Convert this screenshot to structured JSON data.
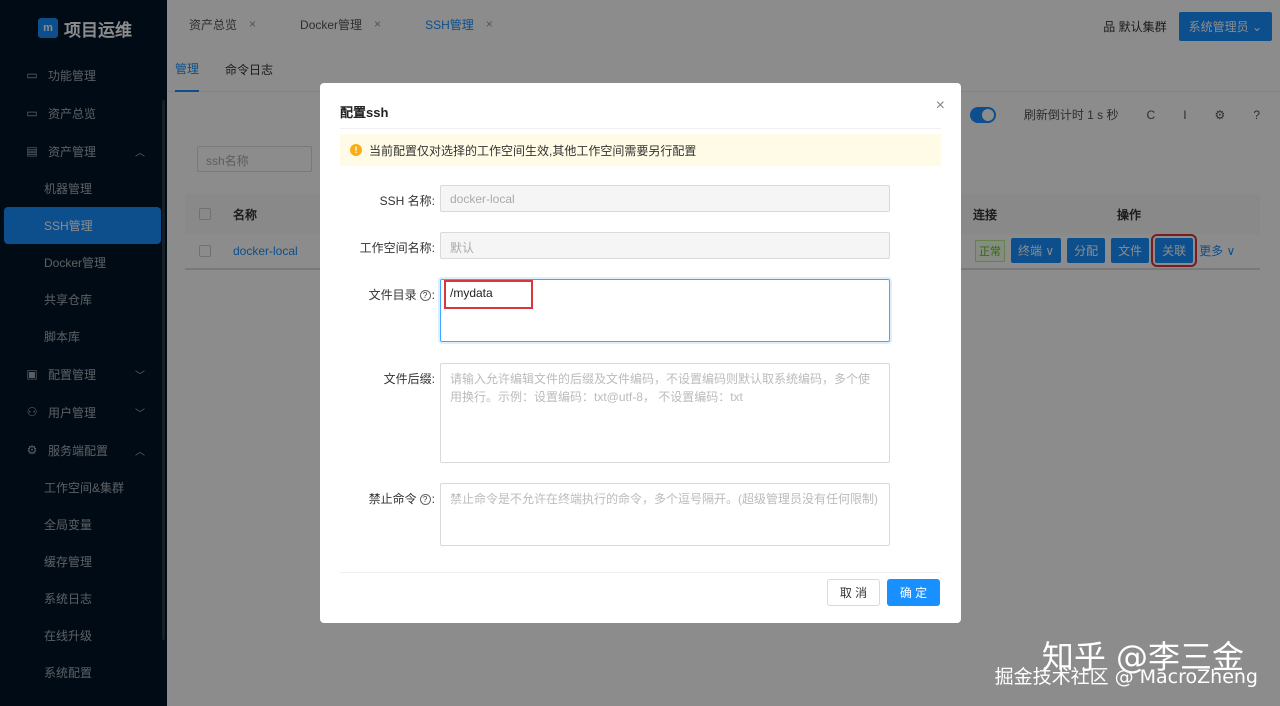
{
  "app": {
    "logo_mark": "m",
    "title": "项目运维"
  },
  "sidebar": {
    "items": [
      {
        "icon": "▭",
        "label": "功能管理"
      },
      {
        "icon": "▭",
        "label": "资产总览"
      },
      {
        "icon": "▤",
        "label": "资产管理",
        "arrow": "︿"
      }
    ],
    "asset_sub": [
      "机器管理",
      "SSH管理",
      "Docker管理",
      "共享仓库",
      "脚本库"
    ],
    "items2": [
      {
        "icon": "▣",
        "label": "配置管理",
        "arrow": "﹀"
      },
      {
        "icon": "⚇",
        "label": "用户管理",
        "arrow": "﹀"
      },
      {
        "icon": "⚙",
        "label": "服务端配置",
        "arrow": "︿"
      }
    ],
    "server_sub": [
      "工作空间&集群",
      "全局变量",
      "缓存管理",
      "系统日志",
      "在线升级",
      "系统配置"
    ]
  },
  "topbar": {
    "tabs": [
      {
        "label": "资产总览",
        "close": "×"
      },
      {
        "label": "Docker管理",
        "close": "×"
      },
      {
        "label": "SSH管理",
        "close": "×"
      }
    ],
    "cluster_label": "品 默认集群",
    "admin_label": "系统管理员 ⌄"
  },
  "page": {
    "subtabs": [
      "管理",
      "命令日志"
    ],
    "refresh_text": "刷新倒计时 1 s 秒",
    "icons": [
      "C",
      "I",
      "⚙",
      "?"
    ],
    "search_placeholder": "ssh名称",
    "columns": {
      "name": "名称",
      "connect": "连接",
      "actions": "操作"
    },
    "row": {
      "name": "docker-local",
      "status": "正常",
      "buttons": [
        "终端 ∨",
        "分配",
        "文件",
        "关联"
      ],
      "more": "更多 ∨"
    }
  },
  "modal": {
    "title": "配置ssh",
    "close": "×",
    "alert": "当前配置仅对选择的工作空间生效,其他工作空间需要另行配置",
    "alert_icon": "!",
    "fields": {
      "ssh_name_label": "SSH 名称:",
      "ssh_name_value": "docker-local",
      "workspace_label": "工作空间名称:",
      "workspace_value": "默认",
      "dir_label": "文件目录",
      "dir_value": "/mydata",
      "suffix_label": "文件后缀:",
      "suffix_placeholder": "请输入允许编辑文件的后缀及文件编码，不设置编码则默认取系统编码，多个使用换行。示例：设置编码：txt@utf-8， 不设置编码：txt",
      "forbid_label": "禁止命令",
      "forbid_placeholder": "禁止命令是不允许在终端执行的命令，多个逗号隔开。(超级管理员没有任何限制)",
      "colon": ":",
      "q": "?"
    },
    "cancel": "取 消",
    "ok": "确 定"
  },
  "watermark": {
    "line1": "知乎 @李三金",
    "line2": "掘金技术社区 @ MacroZheng"
  }
}
